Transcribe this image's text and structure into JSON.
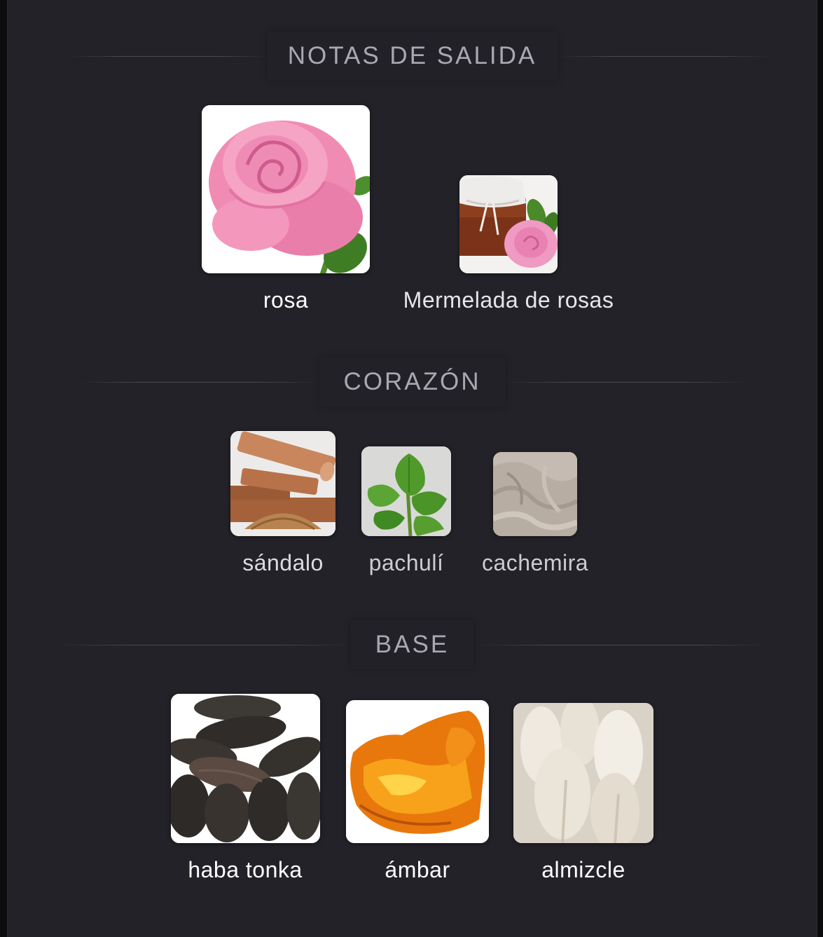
{
  "sections": {
    "top": {
      "title": "NOTAS DE SALIDA",
      "notes": [
        {
          "label": "rosa",
          "icon": "rose-icon"
        },
        {
          "label": "Mermelada de rosas",
          "icon": "rose-jam-icon"
        }
      ]
    },
    "heart": {
      "title": "CORAZÓN",
      "notes": [
        {
          "label": "sándalo",
          "icon": "sandalwood-icon"
        },
        {
          "label": "pachulí",
          "icon": "patchouli-icon"
        },
        {
          "label": "cachemira",
          "icon": "cashmere-icon"
        }
      ]
    },
    "base": {
      "title": "BASE",
      "notes": [
        {
          "label": "haba tonka",
          "icon": "tonka-bean-icon"
        },
        {
          "label": "ámbar",
          "icon": "amber-icon"
        },
        {
          "label": "almizcle",
          "icon": "musk-icon"
        }
      ]
    }
  },
  "colors": {
    "background": "#232228",
    "title_text": "#a9a8b0",
    "label_strong": "#ffffff",
    "label_medium": "#e6e6ea",
    "label_weak": "#cdccd2"
  }
}
